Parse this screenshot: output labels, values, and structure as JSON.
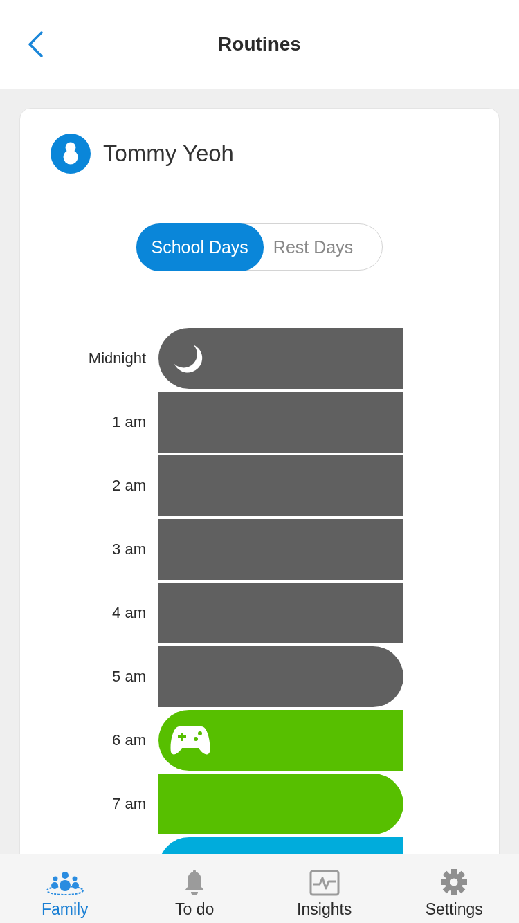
{
  "header": {
    "title": "Routines"
  },
  "profile": {
    "name": "Tommy Yeoh"
  },
  "day_toggle": [
    {
      "label": "School Days",
      "selected": true
    },
    {
      "label": "Rest Days",
      "selected": false
    }
  ],
  "schedule": [
    {
      "label": "Midnight",
      "color": "#606060",
      "round_left": true,
      "round_right": false,
      "kind": "moon"
    },
    {
      "label": "1 am",
      "color": "#606060",
      "round_left": false,
      "round_right": false
    },
    {
      "label": "2 am",
      "color": "#606060",
      "round_left": false,
      "round_right": false
    },
    {
      "label": "3 am",
      "color": "#606060",
      "round_left": false,
      "round_right": false
    },
    {
      "label": "4 am",
      "color": "#606060",
      "round_left": false,
      "round_right": false
    },
    {
      "label": "5 am",
      "color": "#606060",
      "round_left": false,
      "round_right": true
    },
    {
      "label": "6 am",
      "color": "#57bf00",
      "round_left": true,
      "round_right": false,
      "kind": "gamepad"
    },
    {
      "label": "7 am",
      "color": "#57bf00",
      "round_left": false,
      "round_right": true
    },
    {
      "color": "#00acdc",
      "round_left": true,
      "round_right": false
    }
  ],
  "tab_bar": [
    {
      "label": "Family",
      "kind": "family",
      "selected": true
    },
    {
      "label": "To do",
      "kind": "bell",
      "selected": false
    },
    {
      "label": "Insights",
      "kind": "pulse",
      "selected": false
    },
    {
      "label": "Settings",
      "kind": "gear",
      "selected": false
    }
  ]
}
